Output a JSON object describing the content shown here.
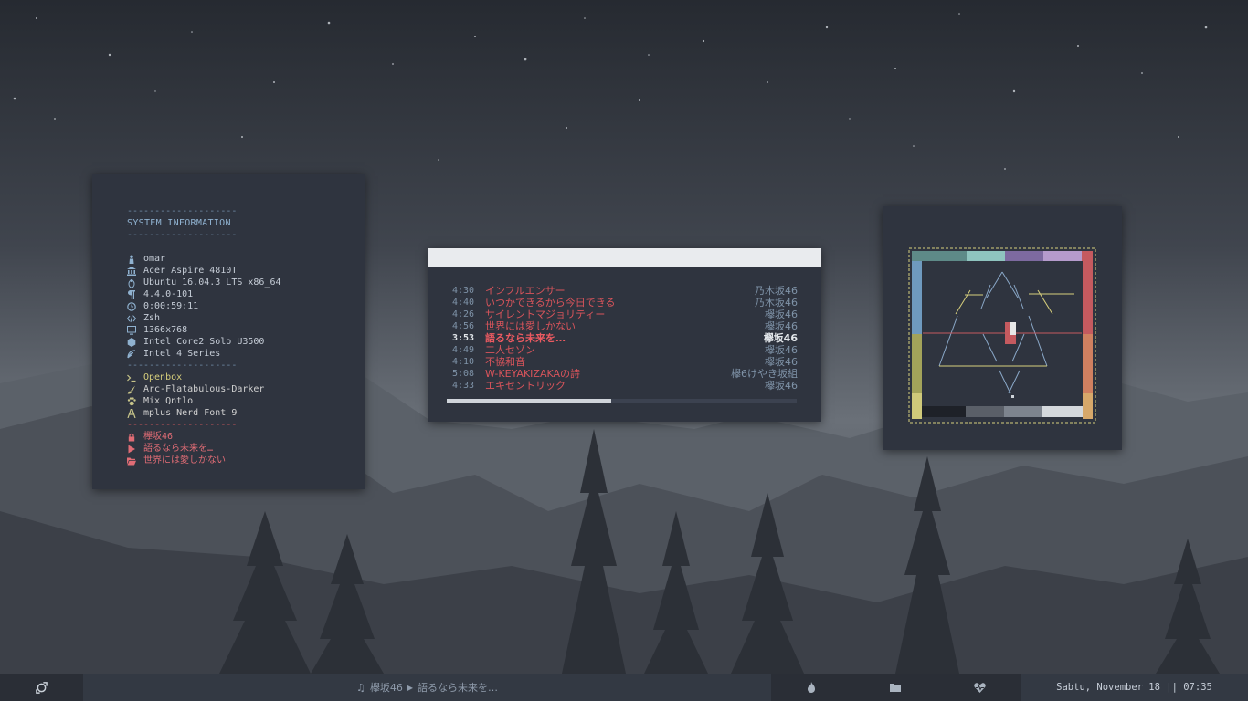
{
  "sysinfo": {
    "dash": "--------------------",
    "title": "SYSTEM INFORMATION",
    "items": [
      {
        "icon": "user-icon",
        "text": "omar"
      },
      {
        "icon": "bank-icon",
        "text": "Acer Aspire 4810T"
      },
      {
        "icon": "linux-icon",
        "text": "Ubuntu 16.04.3 LTS x86_64"
      },
      {
        "icon": "paragraph-icon",
        "text": "4.4.0-101"
      },
      {
        "icon": "clock-icon",
        "text": "0:00:59:11"
      },
      {
        "icon": "code-icon",
        "text": "Zsh"
      },
      {
        "icon": "monitor-icon",
        "text": "1366x768"
      },
      {
        "icon": "cpu-icon",
        "text": "Intel Core2 Solo U3500"
      },
      {
        "icon": "gpu-icon",
        "text": "Intel 4 Series"
      }
    ],
    "wm_items": [
      {
        "icon": "terminal-icon",
        "text": "Openbox"
      },
      {
        "icon": "brush-icon",
        "text": "Arc-Flatabulous-Darker"
      },
      {
        "icon": "paw-icon",
        "text": "Mix Qntlo"
      },
      {
        "icon": "font-icon",
        "text": "mplus Nerd Font 9"
      }
    ],
    "music_items": [
      {
        "icon": "lock-icon",
        "text": "欅坂46"
      },
      {
        "icon": "play-icon",
        "text": "語るなら未来を…"
      },
      {
        "icon": "folder-open-icon",
        "text": "世界には愛しかない"
      }
    ]
  },
  "playlist": {
    "tracks": [
      {
        "duration": "4:30",
        "title": "インフルエンサー",
        "artist": "乃木坂46",
        "current": false
      },
      {
        "duration": "4:40",
        "title": "いつかできるから今日できる",
        "artist": "乃木坂46",
        "current": false
      },
      {
        "duration": "4:26",
        "title": "サイレントマジョリティー",
        "artist": "欅坂46",
        "current": false
      },
      {
        "duration": "4:56",
        "title": "世界には愛しかない",
        "artist": "欅坂46",
        "current": false
      },
      {
        "duration": "3:53",
        "title": "語るなら未来を…",
        "artist": "欅坂46",
        "current": true
      },
      {
        "duration": "4:49",
        "title": "二人セゾン",
        "artist": "欅坂46",
        "current": false
      },
      {
        "duration": "4:10",
        "title": "不協和音",
        "artist": "欅坂46",
        "current": false
      },
      {
        "duration": "5:08",
        "title": "W-KEYAKIZAKAの詩",
        "artist": "欅6けやき坂組",
        "current": false
      },
      {
        "duration": "4:33",
        "title": "エキセントリック",
        "artist": "欅坂46",
        "current": false
      }
    ],
    "progress": 0.47
  },
  "taskbar": {
    "now_playing_artist": "欅坂46",
    "now_playing_title": "語るなら未来を…",
    "clock": "Sabtu, November 18 || 07:35"
  },
  "colors": {
    "panel_bg": "#2f343f",
    "accent_red": "#e06c75",
    "accent_blue": "#7f93a8",
    "accent_yellow": "#d7cf7c"
  }
}
